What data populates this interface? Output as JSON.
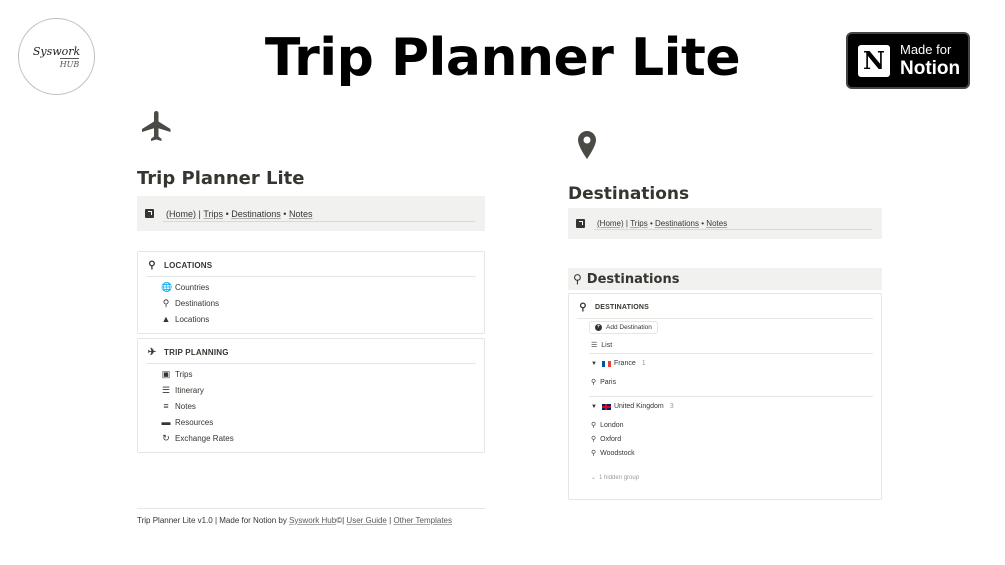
{
  "header": {
    "title": "Trip Planner Lite",
    "logo_script": "Syswork",
    "logo_sub": "HUB",
    "badge_small": "Made for",
    "badge_big": "Notion",
    "badge_letter": "N"
  },
  "left_page": {
    "icon": "airplane-icon",
    "title": "Trip Planner Lite",
    "nav": {
      "home": "(Home)",
      "sep": "|",
      "trips": "Trips",
      "dot": "•",
      "destinations": "Destinations",
      "notes": "Notes"
    },
    "locations": {
      "heading": "LOCATIONS",
      "items": [
        {
          "label": "Countries",
          "icon": "globe-icon"
        },
        {
          "label": "Destinations",
          "icon": "pin-icon"
        },
        {
          "label": "Locations",
          "icon": "compass-icon"
        }
      ]
    },
    "trip_planning": {
      "heading": "TRIP PLANNING",
      "items": [
        {
          "label": "Trips",
          "icon": "luggage-icon"
        },
        {
          "label": "Itinerary",
          "icon": "list-icon"
        },
        {
          "label": "Notes",
          "icon": "notes-icon"
        },
        {
          "label": "Resources",
          "icon": "folder-icon"
        },
        {
          "label": "Exchange Rates",
          "icon": "refresh-icon"
        }
      ]
    },
    "footer": {
      "prefix": "Trip Planner Lite v1.0 | Made for Notion by ",
      "author": "Syswork Hub",
      "c": "©",
      "sep": "|",
      "guide": "User Guide",
      "other": "Other Templates"
    }
  },
  "right_page": {
    "icon": "map-pin-icon",
    "title": "Destinations",
    "nav": {
      "home": "(Home)",
      "sep": "|",
      "trips": "Trips",
      "dot": "•",
      "destinations": "Destinations",
      "notes": "Notes"
    },
    "db_title": "Destinations",
    "db_heading": "DESTINATIONS",
    "add_button": "Add Destination",
    "view": "List",
    "groups": [
      {
        "name": "France",
        "count": "1",
        "items": [
          "Paris"
        ]
      },
      {
        "name": "United Kingdom",
        "count": "3",
        "items": [
          "London",
          "Oxford",
          "Woodstock"
        ]
      }
    ],
    "hidden_group": "1 hidden group"
  }
}
